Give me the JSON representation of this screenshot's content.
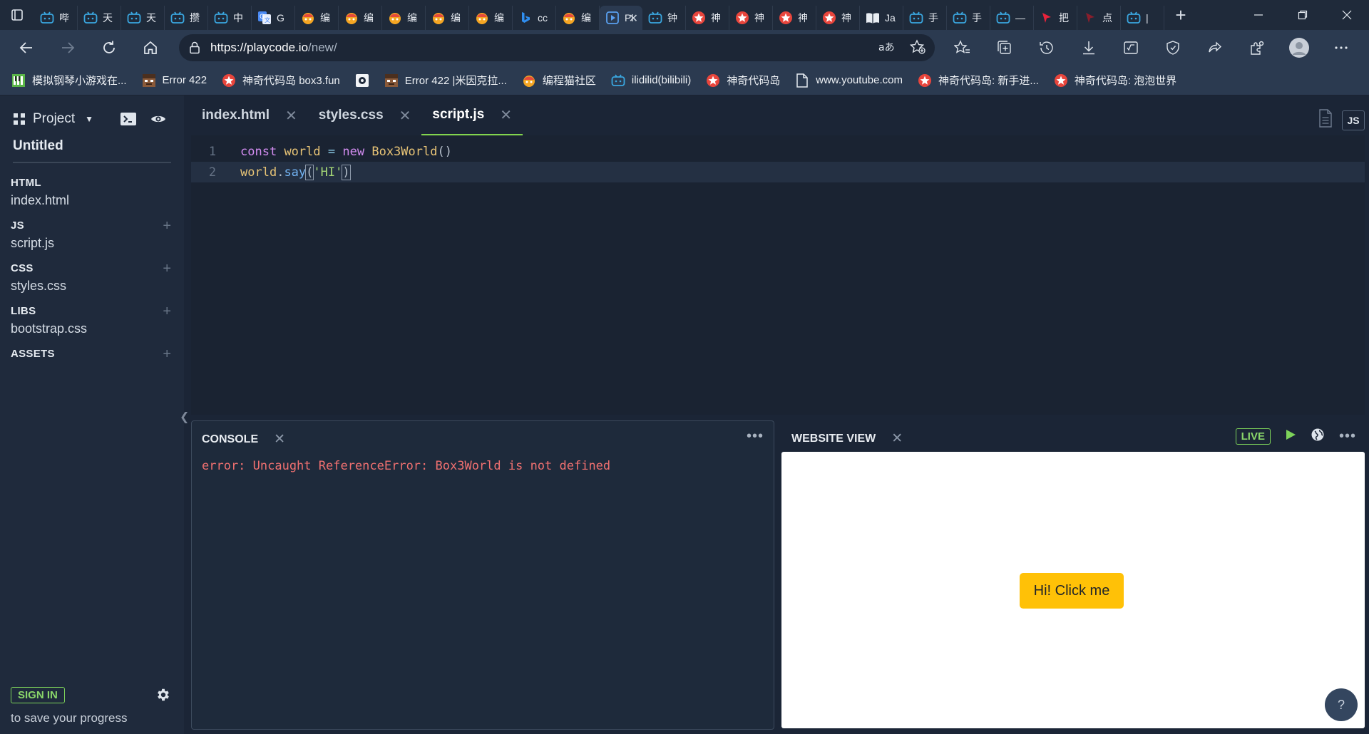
{
  "browser": {
    "tabs": [
      {
        "icon": "bilibili-icon",
        "label": "哔",
        "active": false
      },
      {
        "icon": "bilibili-icon",
        "label": "天",
        "active": false
      },
      {
        "icon": "bilibili-icon",
        "label": "天",
        "active": false
      },
      {
        "icon": "bilibili-icon",
        "label": "攒",
        "active": false
      },
      {
        "icon": "bilibili-icon",
        "label": "中",
        "active": false
      },
      {
        "icon": "translate-icon",
        "label": "G",
        "active": false
      },
      {
        "icon": "codemao-icon",
        "label": "编",
        "active": false
      },
      {
        "icon": "codemao-icon",
        "label": "编",
        "active": false
      },
      {
        "icon": "codemao-icon",
        "label": "编",
        "active": false
      },
      {
        "icon": "codemao-icon",
        "label": "编",
        "active": false
      },
      {
        "icon": "codemao-icon",
        "label": "编",
        "active": false
      },
      {
        "icon": "bing-icon",
        "label": "cc",
        "active": false
      },
      {
        "icon": "codemao-icon",
        "label": "编",
        "active": false
      },
      {
        "icon": "playcode-icon",
        "label": "Pl",
        "active": true
      },
      {
        "icon": "bilibili-icon",
        "label": "钟",
        "active": false
      },
      {
        "icon": "box3-icon",
        "label": "神",
        "active": false
      },
      {
        "icon": "box3-icon",
        "label": "神",
        "active": false
      },
      {
        "icon": "box3-icon",
        "label": "神",
        "active": false
      },
      {
        "icon": "box3-icon",
        "label": "神",
        "active": false
      },
      {
        "icon": "book-icon",
        "label": "Ja",
        "active": false
      },
      {
        "icon": "bilibili-icon",
        "label": "手",
        "active": false
      },
      {
        "icon": "bilibili-icon",
        "label": "手",
        "active": false
      },
      {
        "icon": "bilibili-icon",
        "label": "—",
        "active": false
      },
      {
        "icon": "red-arrow-icon",
        "label": "把",
        "active": false
      },
      {
        "icon": "dark-arrow-icon",
        "label": "点",
        "active": false
      },
      {
        "icon": "bilibili-icon",
        "label": "|",
        "active": false
      }
    ],
    "url_host": "https://playcode.io",
    "url_path": "/new/",
    "bookmarks": [
      {
        "icon": "piano-icon",
        "label": "模拟钢琴小游戏在..."
      },
      {
        "icon": "pixel-face-icon",
        "label": "Error 422"
      },
      {
        "icon": "box3-icon",
        "label": "神奇代码岛 box3.fun"
      },
      {
        "icon": "camera-icon",
        "label": ""
      },
      {
        "icon": "pixel-face-icon",
        "label": "Error 422 |米因克拉..."
      },
      {
        "icon": "codemao-icon",
        "label": "编程猫社区"
      },
      {
        "icon": "bilibili-icon",
        "label": "ilidilid(bilibili)"
      },
      {
        "icon": "box3-icon",
        "label": "神奇代码岛"
      },
      {
        "icon": "page-icon",
        "label": "www.youtube.com"
      },
      {
        "icon": "box3-icon",
        "label": "神奇代码岛: 新手进..."
      },
      {
        "icon": "box3-icon",
        "label": "神奇代码岛: 泡泡世界"
      }
    ]
  },
  "sidebar": {
    "project_label": "Project",
    "project_title": "Untitled",
    "sections": [
      {
        "head": "HTML",
        "file": "index.html",
        "has_add": false
      },
      {
        "head": "JS",
        "file": "script.js",
        "has_add": true
      },
      {
        "head": "CSS",
        "file": "styles.css",
        "has_add": true
      },
      {
        "head": "LIBS",
        "file": "bootstrap.css",
        "has_add": true
      },
      {
        "head": "ASSETS",
        "file": "",
        "has_add": true
      }
    ],
    "sign_in": "SIGN IN",
    "sign_in_sub": "to save your progress"
  },
  "editor": {
    "tabs": [
      {
        "label": "index.html",
        "active": false
      },
      {
        "label": "styles.css",
        "active": false
      },
      {
        "label": "script.js",
        "active": true
      }
    ],
    "lang_badge": "JS",
    "line_numbers": [
      "1",
      "2"
    ],
    "code": {
      "l1_kw": "const",
      "l1_var": "world",
      "l1_op": "=",
      "l1_new": "new",
      "l1_cls": "Box3World",
      "l1_paren": "()",
      "l2_obj": "world",
      "l2_dot": ".",
      "l2_fn": "say",
      "l2_open": "(",
      "l2_str": "'HI'",
      "l2_close": ")"
    }
  },
  "console": {
    "title": "CONSOLE",
    "error": "error: Uncaught ReferenceError: Box3World is not defined"
  },
  "website_view": {
    "title": "WEBSITE VIEW",
    "live": "LIVE",
    "button_label": "Hi! Click me",
    "help": "?"
  },
  "colors": {
    "accent_green": "#82d44e",
    "error_red": "#f07070",
    "button_yellow": "#ffc107"
  }
}
